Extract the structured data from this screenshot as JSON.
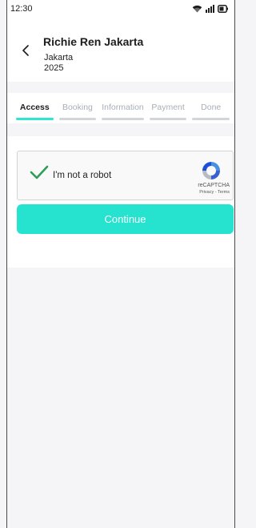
{
  "status_bar": {
    "time": "12:30",
    "icons": [
      "wifi-icon",
      "signal-icon",
      "battery-icon"
    ]
  },
  "header": {
    "back_icon": "chevron-left-icon",
    "title": "Richie Ren Jakarta",
    "subtitle_line1": "Jakarta",
    "subtitle_line2": "2025"
  },
  "steps": [
    {
      "label": "Access",
      "active": true
    },
    {
      "label": "Booking",
      "active": false
    },
    {
      "label": "Information",
      "active": false
    },
    {
      "label": "Payment",
      "active": false
    },
    {
      "label": "Done",
      "active": false
    }
  ],
  "recaptcha": {
    "label": "I'm not a robot",
    "checked": true,
    "brand": "reCAPTCHA",
    "links": "Privacy - Terms"
  },
  "actions": {
    "continue_label": "Continue"
  },
  "colors": {
    "accent": "#25e3cf",
    "check": "#2e9e56",
    "background": "#f5f5f7"
  }
}
